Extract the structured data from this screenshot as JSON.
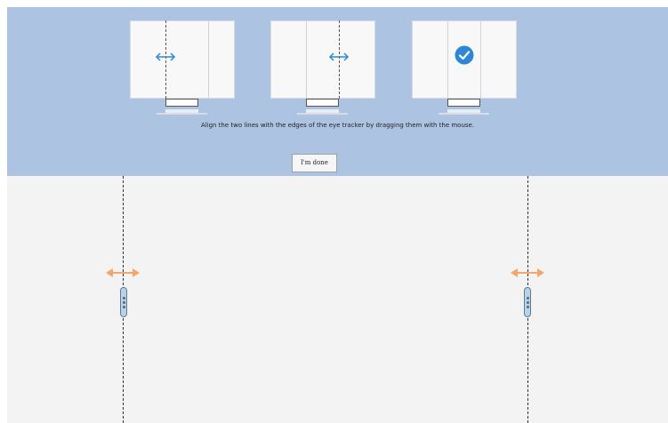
{
  "instructions": {
    "text": "Align the two lines with the edges of the eye tracker by dragging them with the mouse."
  },
  "done_button": {
    "label": "I'm done"
  },
  "illustrations": [
    {
      "name": "step-move-left-line",
      "icon": "double-arrow-icon"
    },
    {
      "name": "step-move-right-line",
      "icon": "double-arrow-icon"
    },
    {
      "name": "step-aligned",
      "icon": "check-circle-icon"
    }
  ],
  "colors": {
    "panel": "#adc3e2",
    "canvas": "#f3f3f3",
    "arrow_blue": "#2b8ad8",
    "arrow_orange": "#f2a86a",
    "check_blue": "#2f86d6"
  }
}
